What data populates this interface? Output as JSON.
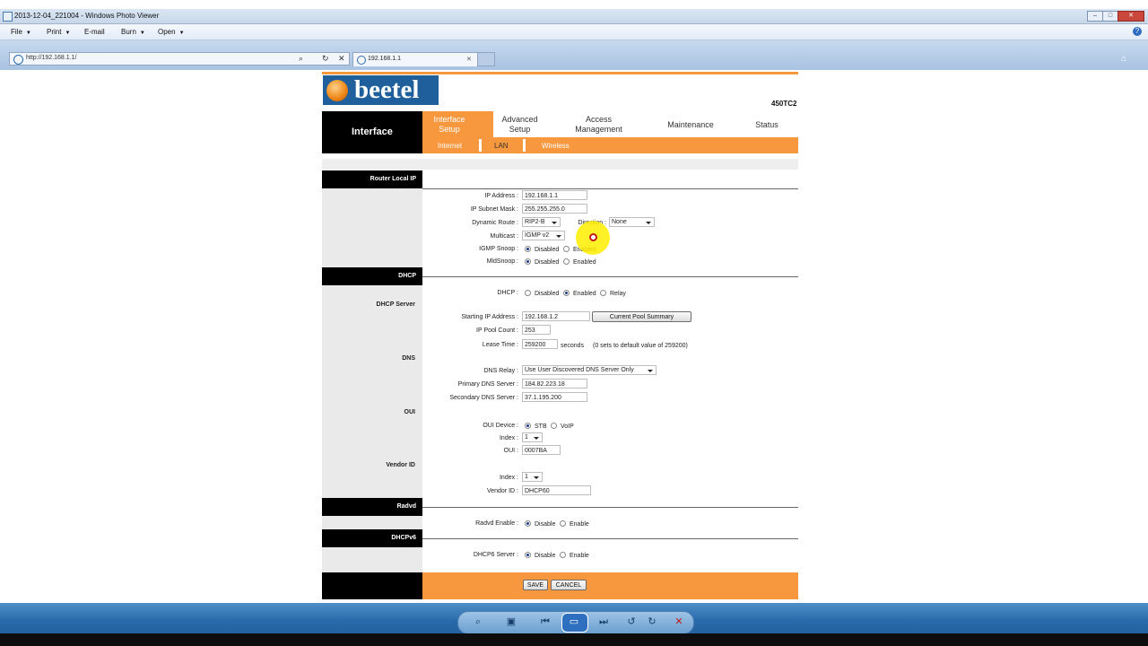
{
  "window": {
    "title": "2013-12-04_221004 - Windows Photo Viewer"
  },
  "menubar": {
    "file": "File",
    "print": "Print",
    "email": "E-mail",
    "burn": "Burn",
    "open": "Open"
  },
  "browser": {
    "address": "http://192.168.1.1/",
    "tab_title": "192.168.1.1"
  },
  "header": {
    "logo_text": "beetel",
    "model": "450TC2"
  },
  "nav": {
    "section": "Interface",
    "tabs": [
      {
        "label": "Interface Setup"
      },
      {
        "label": "Advanced Setup"
      },
      {
        "label": "Access Management"
      },
      {
        "label": "Maintenance"
      },
      {
        "label": "Status"
      }
    ],
    "subtabs": [
      {
        "label": "Internet"
      },
      {
        "label": "LAN"
      },
      {
        "label": "Wireless"
      }
    ]
  },
  "router_local_ip": {
    "heading": "Router Local IP",
    "ip_label": "IP Address :",
    "ip_value": "192.168.1.1",
    "mask_label": "IP Subnet Mask :",
    "mask_value": "255.255.255.0",
    "route_label": "Dynamic Route :",
    "route_value": "RIP2-B",
    "direction_label": "Direction :",
    "direction_value": "None",
    "multicast_label": "Multicast :",
    "multicast_value": "IGMP v2",
    "igmp_label": "IGMP Snoop :",
    "mld_label": "MldSnoop :",
    "disabled": "Disabled",
    "enabled": "Enabled"
  },
  "dhcp": {
    "heading": "DHCP",
    "dhcp_label": "DHCP :",
    "opt_disabled": "Disabled",
    "opt_enabled": "Enabled",
    "opt_relay": "Relay",
    "server_heading": "DHCP Server",
    "start_label": "Starting IP Address :",
    "start_value": "192.168.1.2",
    "pool_button": "Current Pool Summary",
    "count_label": "IP Pool Count :",
    "count_value": "253",
    "lease_label": "Lease Time :",
    "lease_value": "259200",
    "lease_unit": "seconds",
    "lease_note": "(0 sets to default value of 259200)",
    "dns_heading": "DNS",
    "relay_label": "DNS Relay :",
    "relay_value": "Use User Discovered DNS Server Only",
    "primary_label": "Primary DNS Server :",
    "primary_value": "184.82.223.18",
    "secondary_label": "Secondary DNS Server :",
    "secondary_value": "37.1.195.200",
    "oui_heading": "OUI",
    "oui_device_label": "OUI Device :",
    "stb": "STB",
    "voip": "VoIP",
    "index_label": "Index :",
    "index_value": "1",
    "oui_label": "OUI :",
    "oui_value": "0007BA",
    "vendor_heading": "Vendor ID",
    "vendor_index_label": "Index :",
    "vendor_index_value": "1",
    "vendor_label": "Vendor ID :",
    "vendor_value": "DHCP60"
  },
  "radvd": {
    "heading": "Radvd",
    "label": "Radvd Enable :",
    "disable": "Disable",
    "enable": "Enable"
  },
  "dhcpv6": {
    "heading": "DHCPv6",
    "label": "DHCP6 Server :",
    "disable": "Disable",
    "enable": "Enable"
  },
  "actions": {
    "save": "SAVE",
    "cancel": "CANCEL"
  },
  "colors": {
    "accent": "#f7973e",
    "nav_black": "#000000"
  }
}
